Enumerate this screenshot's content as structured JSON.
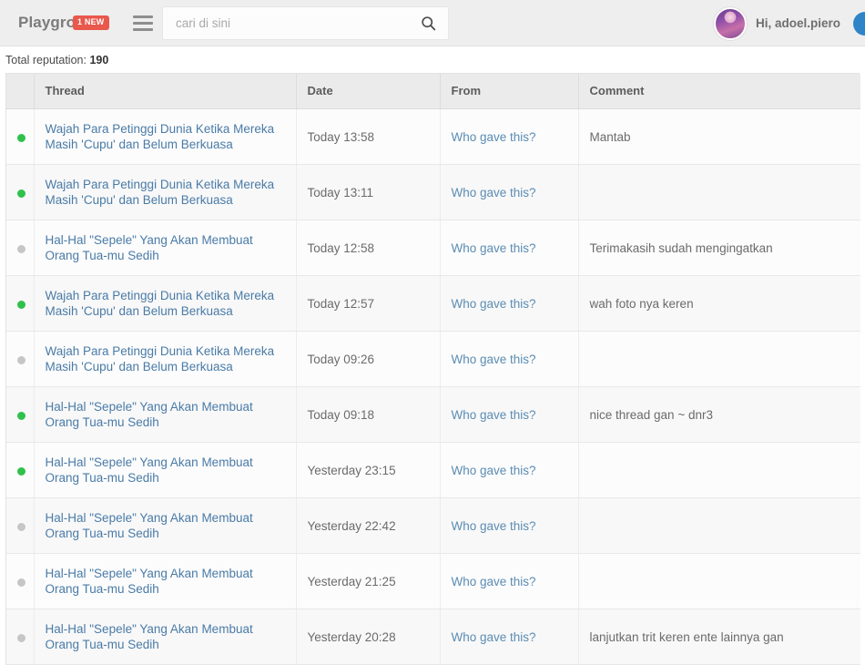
{
  "topbar": {
    "brand": "Playground",
    "brand_badge": "1 NEW",
    "menu_icon": "hamburger-icon",
    "search": {
      "placeholder": "cari di sini",
      "value": "",
      "icon": "search-icon"
    },
    "user": {
      "greeting": "Hi, adoel.piero",
      "avatar_icon": "user-avatar"
    },
    "edge_icon": "blue-circle-icon"
  },
  "reputation": {
    "label": "Total reputation:",
    "value": "190"
  },
  "table": {
    "columns": [
      "Thread",
      "Date",
      "From",
      "Comment"
    ],
    "from_link_label": "Who gave this?",
    "rows": [
      {
        "status": "positive",
        "thread": "Wajah Para Petinggi Dunia Ketika Mereka Masih 'Cupu' dan Belum Berkuasa",
        "date": "Today 13:58",
        "from": "Who gave this?",
        "comment": "Mantab"
      },
      {
        "status": "positive",
        "thread": "Wajah Para Petinggi Dunia Ketika Mereka Masih 'Cupu' dan Belum Berkuasa",
        "date": "Today 13:11",
        "from": "Who gave this?",
        "comment": ""
      },
      {
        "status": "neutral",
        "thread": "Hal-Hal \"Sepele\" Yang Akan Membuat Orang Tua-mu Sedih",
        "date": "Today 12:58",
        "from": "Who gave this?",
        "comment": "Terimakasih sudah mengingatkan"
      },
      {
        "status": "positive",
        "thread": "Wajah Para Petinggi Dunia Ketika Mereka Masih 'Cupu' dan Belum Berkuasa",
        "date": "Today 12:57",
        "from": "Who gave this?",
        "comment": "wah foto nya keren"
      },
      {
        "status": "neutral",
        "thread": "Wajah Para Petinggi Dunia Ketika Mereka Masih 'Cupu' dan Belum Berkuasa",
        "date": "Today 09:26",
        "from": "Who gave this?",
        "comment": ""
      },
      {
        "status": "positive",
        "thread": "Hal-Hal \"Sepele\" Yang Akan Membuat Orang Tua-mu Sedih",
        "date": "Today 09:18",
        "from": "Who gave this?",
        "comment": "nice thread gan ~ dnr3"
      },
      {
        "status": "positive",
        "thread": "Hal-Hal \"Sepele\" Yang Akan Membuat Orang Tua-mu Sedih",
        "date": "Yesterday 23:15",
        "from": "Who gave this?",
        "comment": ""
      },
      {
        "status": "neutral",
        "thread": "Hal-Hal \"Sepele\" Yang Akan Membuat Orang Tua-mu Sedih",
        "date": "Yesterday 22:42",
        "from": "Who gave this?",
        "comment": ""
      },
      {
        "status": "neutral",
        "thread": "Hal-Hal \"Sepele\" Yang Akan Membuat Orang Tua-mu Sedih",
        "date": "Yesterday 21:25",
        "from": "Who gave this?",
        "comment": ""
      },
      {
        "status": "neutral",
        "thread": "Hal-Hal \"Sepele\" Yang Akan Membuat Orang Tua-mu Sedih",
        "date": "Yesterday 20:28",
        "from": "Who gave this?",
        "comment": "lanjutkan trit keren ente lainnya gan"
      }
    ]
  },
  "colors": {
    "badge_red": "#e9574d",
    "status_positive": "#2fc14c",
    "status_neutral": "#c6c6c6",
    "link_blue": "#4a7ba7",
    "topbar_bg": "#eeeeee"
  }
}
